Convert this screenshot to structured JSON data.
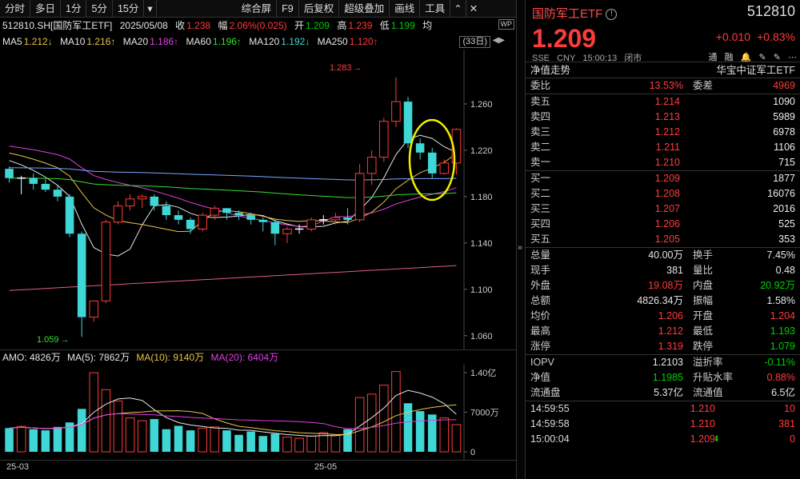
{
  "toolbar": {
    "left_items": [
      "分时",
      "多日",
      "1分",
      "5分",
      "15分"
    ],
    "dropdown": "▾",
    "right_items": [
      "综合屏",
      "F9",
      "后复权",
      "超级叠加",
      "画线",
      "工具"
    ],
    "collapse": "⌃",
    "close": "✕"
  },
  "info": {
    "symbol": "512810.SH[国防军工ETF]",
    "date": "2025/05/08",
    "close_label": "收",
    "close": "1.238",
    "amp_label": "幅",
    "amp": "2.06%(0.025)",
    "open_label": "开",
    "open": "1.209",
    "high_label": "高",
    "high": "1.239",
    "low_label": "低",
    "low": "1.199",
    "avg_label": "均",
    "wp_badge": "WP"
  },
  "ma": {
    "ma5": "MA5",
    "ma5_val": "1.212↓",
    "ma10": "MA10",
    "ma10_val": "1.216↑",
    "ma20": "MA20",
    "ma20_val": "1.186↑",
    "ma60": "MA60",
    "ma60_val": "1.196↑",
    "ma120": "MA120",
    "ma120_val": "1.192↓",
    "ma250": "MA250",
    "ma250_val": "1.120↑",
    "period": "(33日)",
    "prev": "◀",
    "next": "▶"
  },
  "price_axis": [
    "1.260",
    "1.220",
    "1.180",
    "1.140",
    "1.100",
    "1.060"
  ],
  "annotations": {
    "high": "1.283",
    "low": "1.059",
    "high_arrow": "→",
    "low_arrow": "→"
  },
  "volume": {
    "title": "AMO: 4826万",
    "ma5": "MA(5): 7862万",
    "ma10": "MA(10): 9140万",
    "ma20": "MA(20): 6404万",
    "axis": [
      "1.40亿",
      "7000万",
      "0"
    ]
  },
  "dates": [
    "25-03",
    "25-05"
  ],
  "colors": {
    "up": "#ff3b3b",
    "down": "#3fd6d6",
    "ma5": "#e6e6e6",
    "ma10": "#e8c34a",
    "ma20": "#e040e0",
    "ma60": "#30e030",
    "ma120": "#7aa6ff",
    "ma250": "#e06080",
    "highlight": "#f0f000"
  },
  "chart_data": {
    "type": "candlestick",
    "open": [
      1.204,
      1.196,
      1.196,
      1.191,
      1.186,
      1.18,
      1.148,
      1.076,
      1.09,
      1.158,
      1.172,
      1.178,
      1.18,
      1.172,
      1.164,
      1.16,
      1.152,
      1.164,
      1.17,
      1.166,
      1.164,
      1.16,
      1.158,
      1.148,
      1.152,
      1.152,
      1.16,
      1.16,
      1.162,
      1.16,
      1.2,
      1.214,
      1.245,
      1.262,
      1.226,
      1.218,
      1.2,
      1.209
    ],
    "close": [
      1.196,
      1.196,
      1.191,
      1.186,
      1.18,
      1.148,
      1.076,
      1.09,
      1.158,
      1.172,
      1.178,
      1.18,
      1.172,
      1.164,
      1.16,
      1.152,
      1.164,
      1.17,
      1.166,
      1.164,
      1.16,
      1.158,
      1.148,
      1.152,
      1.152,
      1.16,
      1.16,
      1.162,
      1.16,
      1.2,
      1.214,
      1.245,
      1.262,
      1.226,
      1.218,
      1.2,
      1.209,
      1.238
    ],
    "high": [
      1.206,
      1.198,
      1.2,
      1.195,
      1.19,
      1.182,
      1.15,
      1.08,
      1.16,
      1.176,
      1.182,
      1.182,
      1.182,
      1.176,
      1.168,
      1.162,
      1.166,
      1.172,
      1.17,
      1.168,
      1.166,
      1.162,
      1.16,
      1.154,
      1.156,
      1.162,
      1.164,
      1.166,
      1.17,
      1.208,
      1.22,
      1.248,
      1.283,
      1.266,
      1.23,
      1.222,
      1.212,
      1.239
    ],
    "low": [
      1.192,
      1.182,
      1.186,
      1.184,
      1.176,
      1.145,
      1.059,
      1.072,
      1.088,
      1.156,
      1.168,
      1.17,
      1.168,
      1.16,
      1.156,
      1.148,
      1.15,
      1.16,
      1.16,
      1.16,
      1.156,
      1.15,
      1.138,
      1.14,
      1.148,
      1.15,
      1.156,
      1.156,
      1.156,
      1.158,
      1.19,
      1.21,
      1.24,
      1.222,
      1.212,
      1.196,
      1.199,
      1.199
    ],
    "volume": [
      0.42,
      0.45,
      0.4,
      0.38,
      0.44,
      0.52,
      0.76,
      1.4,
      1.1,
      0.9,
      0.6,
      0.55,
      0.58,
      0.4,
      0.46,
      0.38,
      0.42,
      0.44,
      0.38,
      0.3,
      0.36,
      0.28,
      0.32,
      0.26,
      0.24,
      0.28,
      0.34,
      0.3,
      0.4,
      0.96,
      1.02,
      1.18,
      1.42,
      0.86,
      0.72,
      0.66,
      0.6,
      0.48
    ],
    "ylim": [
      1.055,
      1.3
    ]
  },
  "panel": {
    "name": "国防军工ETF",
    "code": "512810",
    "price": "1.209",
    "change": "+0.010",
    "pct": "+0.83%",
    "meta": [
      "SSE",
      "CNY",
      "15:00:13",
      "闭市"
    ],
    "tools": [
      "通",
      "融",
      "🔔",
      "✎",
      "✎",
      "⋯"
    ],
    "nav_left": "净值走势",
    "nav_right": "华宝中证军工ETF",
    "weibi": {
      "l1": "委比",
      "v1": "13.53%",
      "l2": "委差",
      "v2": "4969"
    },
    "asks": [
      {
        "label": "卖五",
        "price": "1.214",
        "vol": "1090"
      },
      {
        "label": "卖四",
        "price": "1.213",
        "vol": "5989"
      },
      {
        "label": "卖三",
        "price": "1.212",
        "vol": "6978"
      },
      {
        "label": "卖二",
        "price": "1.211",
        "vol": "1106"
      },
      {
        "label": "卖一",
        "price": "1.210",
        "vol": "715"
      }
    ],
    "bids": [
      {
        "label": "买一",
        "price": "1.209",
        "vol": "1877"
      },
      {
        "label": "买二",
        "price": "1.208",
        "vol": "16076"
      },
      {
        "label": "买三",
        "price": "1.207",
        "vol": "2016"
      },
      {
        "label": "买四",
        "price": "1.206",
        "vol": "525"
      },
      {
        "label": "买五",
        "price": "1.205",
        "vol": "353"
      }
    ],
    "stats": [
      {
        "l1": "总量",
        "v1": "40.00万",
        "c1": "white",
        "l2": "换手",
        "v2": "7.45%",
        "c2": "white"
      },
      {
        "l1": "现手",
        "v1": "381",
        "c1": "white",
        "l2": "量比",
        "v2": "0.48",
        "c2": "white"
      },
      {
        "l1": "外盘",
        "v1": "19.08万",
        "c1": "red",
        "l2": "内盘",
        "v2": "20.92万",
        "c2": "green"
      },
      {
        "l1": "总额",
        "v1": "4826.34万",
        "c1": "white",
        "l2": "振幅",
        "v2": "1.58%",
        "c2": "white"
      },
      {
        "l1": "均价",
        "v1": "1.206",
        "c1": "red",
        "l2": "开盘",
        "v2": "1.204",
        "c2": "red"
      },
      {
        "l1": "最高",
        "v1": "1.212",
        "c1": "red",
        "l2": "最低",
        "v2": "1.193",
        "c2": "green"
      },
      {
        "l1": "涨停",
        "v1": "1.319",
        "c1": "red",
        "l2": "跌停",
        "v2": "1.079",
        "c2": "green"
      }
    ],
    "iopv": [
      {
        "l1": "IOPV",
        "v1": "1.2103",
        "c1": "white",
        "l2": "溢折率",
        "v2": "-0.11%",
        "c2": "green"
      },
      {
        "l1": "净值",
        "v1": "1.1985",
        "c1": "green",
        "l2": "升贴水率",
        "v2": "0.88%",
        "c2": "red"
      },
      {
        "l1": "流通盘",
        "v1": "5.37亿",
        "c1": "white",
        "l2": "流通值",
        "v2": "6.5亿",
        "c2": "white"
      }
    ],
    "ticks": [
      {
        "time": "14:59:55",
        "price": "1.210",
        "arrow": "",
        "vol": "10",
        "pc": "red",
        "vc": "red"
      },
      {
        "time": "14:59:58",
        "price": "1.210",
        "arrow": "",
        "vol": "381",
        "pc": "red",
        "vc": "red"
      },
      {
        "time": "15:00:04",
        "price": "1.209",
        "arrow": "⬇",
        "vol": "0",
        "pc": "red",
        "vc": "red"
      }
    ]
  }
}
